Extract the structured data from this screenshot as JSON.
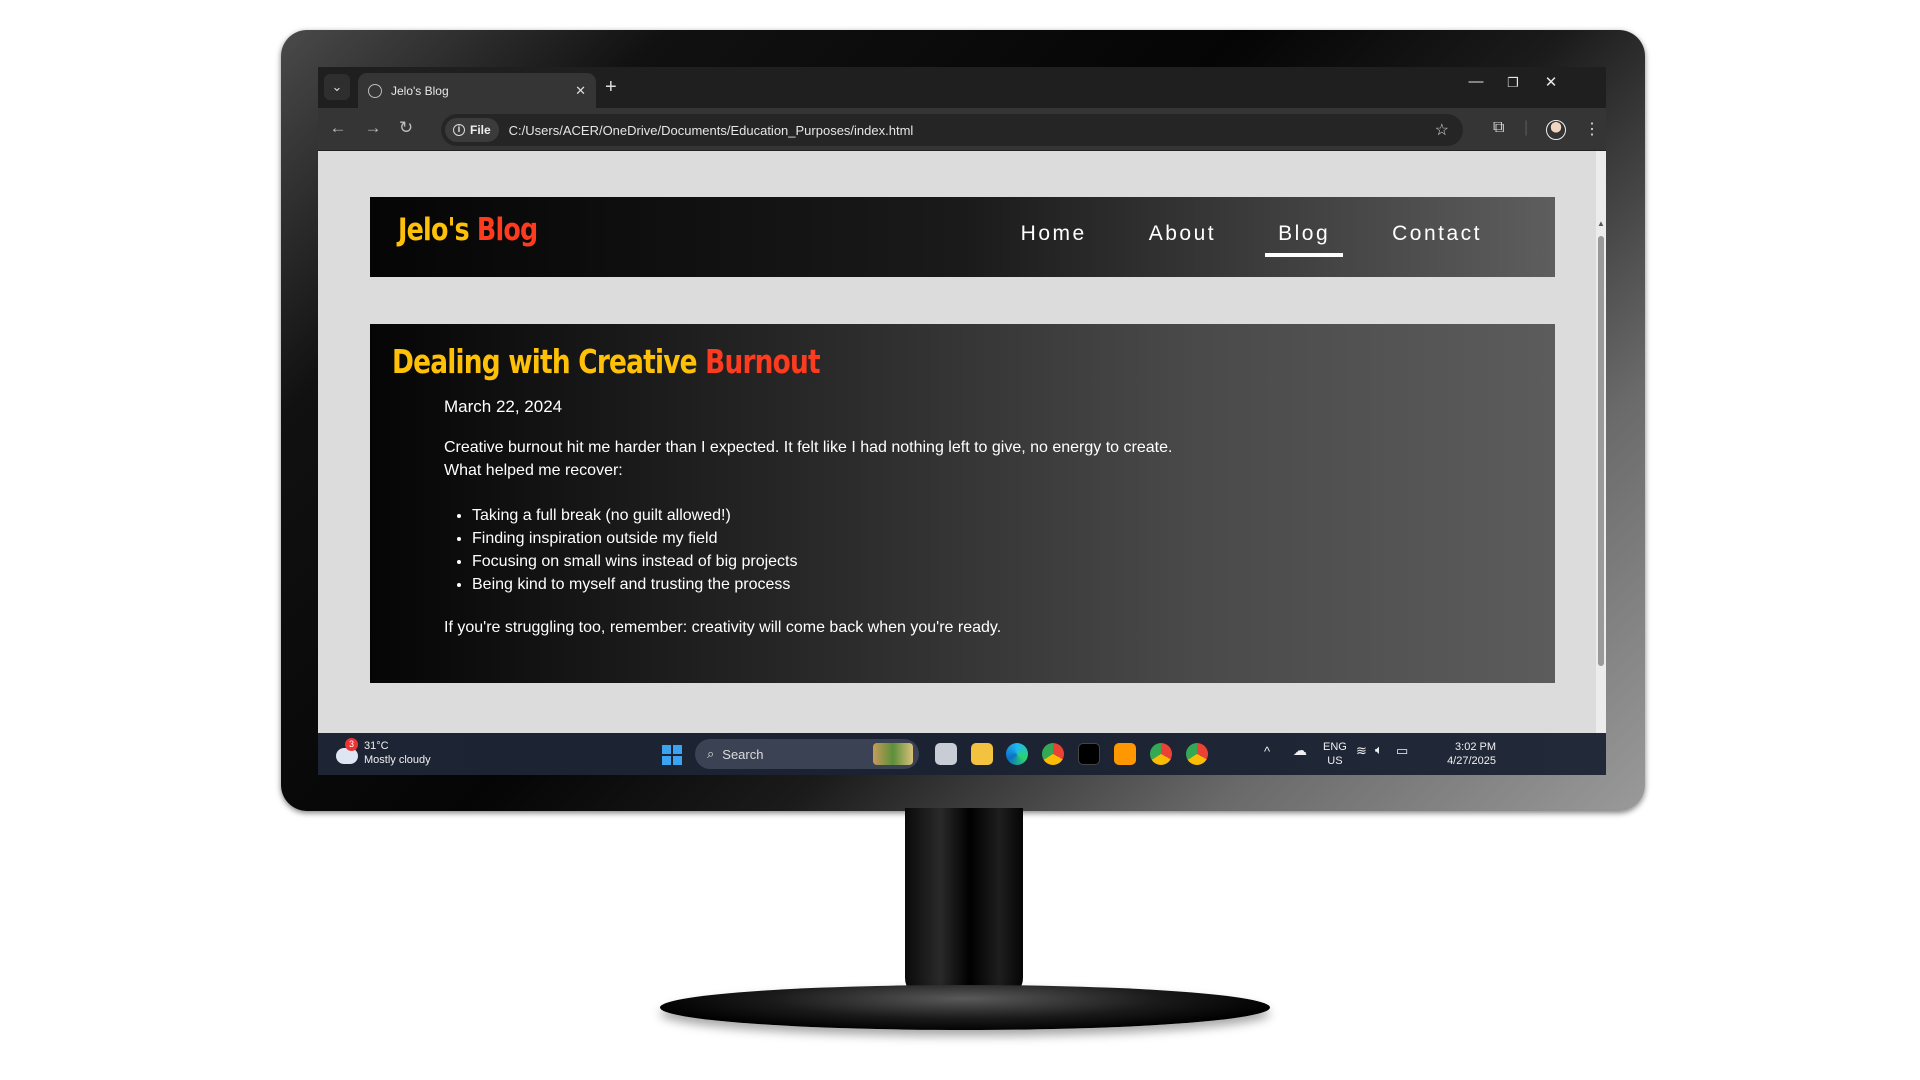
{
  "browser": {
    "tab_title": "Jelo's Blog",
    "url_scheme_label": "File",
    "url": "C:/Users/ACER/OneDrive/Documents/Education_Purposes/index.html"
  },
  "site": {
    "logo_part1": "Jelo's ",
    "logo_part2": "Blog",
    "nav": [
      "Home",
      "About",
      "Blog",
      "Contact"
    ],
    "active_nav": "Blog"
  },
  "post": {
    "title_part1": "Dealing with Creative ",
    "title_part2": "Burnout",
    "date": "March 22, 2024",
    "intro_line1": "Creative burnout hit me harder than I expected. It felt like I had nothing left to give, no energy to create.",
    "intro_line2": "What helped me recover:",
    "list": [
      "Taking a full break (no guilt allowed!)",
      "Finding inspiration outside my field",
      "Focusing on small wins instead of big projects",
      "Being kind to myself and trusting the process"
    ],
    "outro": "If you're struggling too, remember: creativity will come back when you're ready."
  },
  "taskbar": {
    "weather_temp": "31°C",
    "weather_desc": "Mostly cloudy",
    "weather_badge": "3",
    "search_label": "Search",
    "lang_line1": "ENG",
    "lang_line2": "US",
    "time": "3:02 PM",
    "date": "4/27/2025"
  },
  "colors": {
    "accent_yellow": "#ffc107",
    "accent_red": "#ff3b1f",
    "page_bg": "#dcdcdc"
  }
}
